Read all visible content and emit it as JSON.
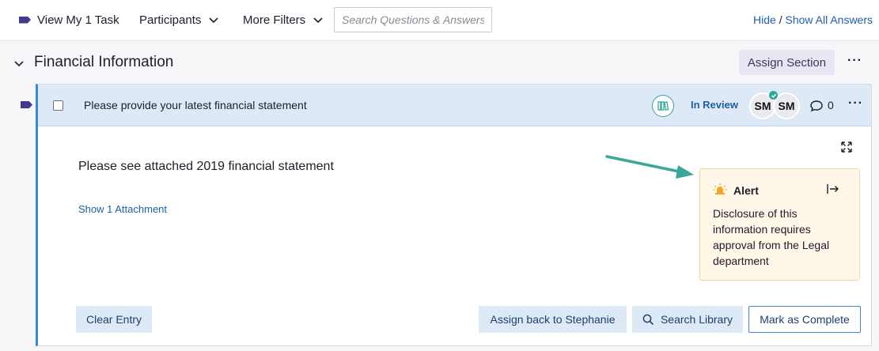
{
  "filterbar": {
    "my_tasks_label": "View My 1 Task",
    "participants_label": "Participants",
    "more_filters_label": "More Filters",
    "search_placeholder": "Search Questions & Answers",
    "hide_label": "Hide",
    "separator": "/",
    "show_all_label": "Show All Answers"
  },
  "section": {
    "title": "Financial Information",
    "assign_label": "Assign Section",
    "more_label": "···"
  },
  "question": {
    "text": "Please provide your latest financial statement",
    "status": "In Review",
    "avatars": [
      "SM",
      "SM"
    ],
    "comment_count": "0",
    "more_label": "···",
    "answer": "Please see attached 2019 financial statement",
    "attachment_link": "Show 1 Attachment"
  },
  "alert": {
    "title": "Alert",
    "body": "Disclosure of this information requires approval from the Legal department"
  },
  "actions": {
    "clear": "Clear Entry",
    "assign_back": "Assign back to Stephanie",
    "search_library": "Search Library",
    "mark_complete": "Mark as Complete"
  },
  "colors": {
    "accent": "#3b88d0",
    "link": "#1f5fa5",
    "tag": "#3d3a8f",
    "teal": "#2fa89a",
    "alert_bg": "#fff8e9"
  },
  "icons": [
    "tag-icon",
    "chevron-down-icon",
    "library-icon",
    "check-icon",
    "comment-icon",
    "expand-icon",
    "siren-icon",
    "exit-icon",
    "search-icon",
    "arrow-icon"
  ]
}
